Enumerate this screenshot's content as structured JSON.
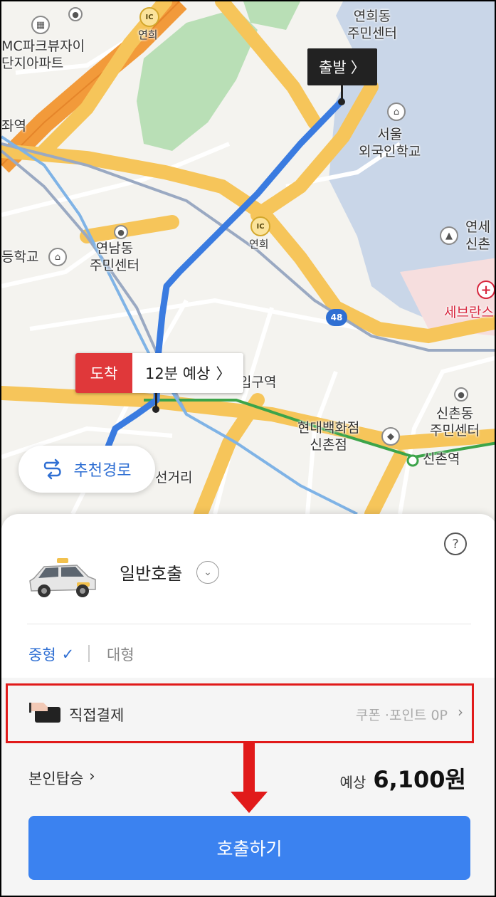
{
  "map": {
    "labels": {
      "dmc_1": "MC파크뷰자이",
      "dmc_2": "단지아파트",
      "station_gajwa": "좌역",
      "yeonhui_center_1": "연희동",
      "yeonhui_center_2": "주민센터",
      "seoul_foreign_1": "서울",
      "seoul_foreign_2": "외국인학교",
      "yeonnam_center_1": "연남동",
      "yeonnam_center_2": "주민센터",
      "school_left": "등학교",
      "ic_top": "연희",
      "ic_mid": "연희",
      "yonsei_1": "연세",
      "yonsei_2": "신촌",
      "severance": "세브란스",
      "hongik_station": "입구역",
      "hyundai_1": "현대백화점",
      "hyundai_2": "신촌점",
      "sinchon_center_1": "신촌동",
      "sinchon_center_2": "주민센터",
      "sinchon_station": "신촌역",
      "intersection": "선거리",
      "road_48": "48",
      "ic_badge": "IC"
    },
    "start_flag": {
      "label": "출발",
      "chevron": "〉"
    },
    "arrive_flag": {
      "label": "도착",
      "eta": "12분 예상",
      "chevron": "〉"
    },
    "recommend_button": {
      "label": "추천경로",
      "icon": "route-icon"
    }
  },
  "sheet": {
    "help": "?",
    "service": {
      "name": "일반호출",
      "chevron": "⌄",
      "icon": "taxi-icon"
    },
    "sizes": {
      "mid": "중형",
      "mid_check": "✓",
      "large": "대형"
    },
    "payment": {
      "label": "직접결제",
      "coupon": "쿠폰 ·포인트 0P",
      "chevron": "›",
      "icon": "card-icon"
    },
    "self_ride": {
      "label": "본인탑승",
      "chevron": "›"
    },
    "price": {
      "prefix": "예상",
      "value": "6,100원"
    },
    "call_button": "호출하기"
  },
  "colors": {
    "accent": "#3b82f0",
    "arrive_red": "#e0383a",
    "annotation_red": "#e11a1a",
    "route_blue": "#3a7be0",
    "highway_yellow": "#f6c55a",
    "highway_orange": "#f29a3a"
  }
}
